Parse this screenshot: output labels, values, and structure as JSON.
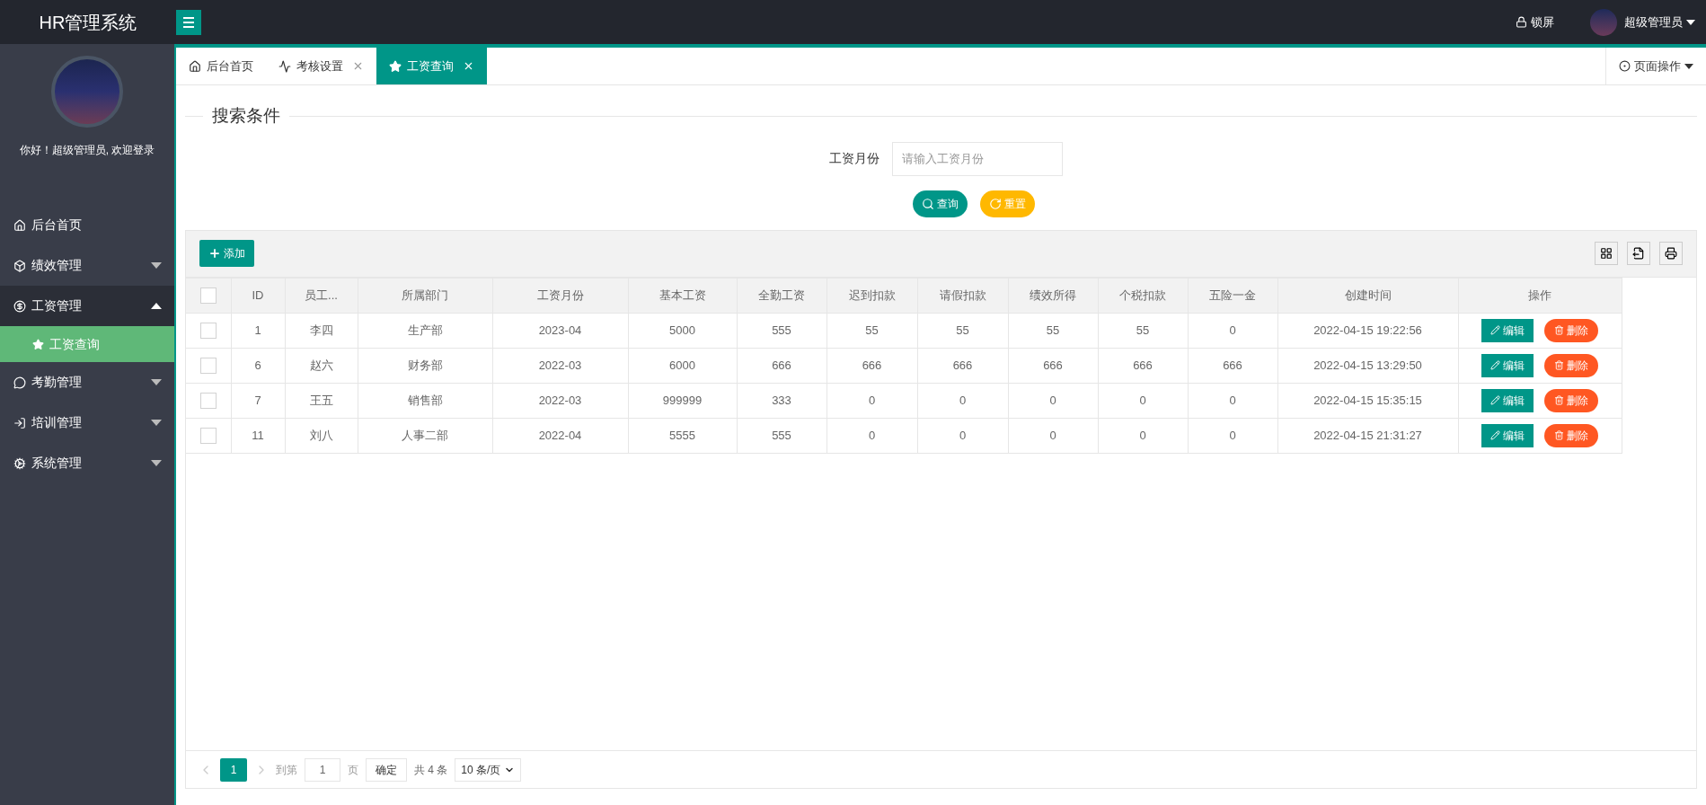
{
  "header": {
    "logo": "HR管理系统",
    "lock_label": "锁屏",
    "user_name": "超级管理员"
  },
  "sidebar": {
    "greeting": "你好！超级管理员, 欢迎登录",
    "items": [
      {
        "label": "后台首页",
        "kind": "link"
      },
      {
        "label": "绩效管理",
        "kind": "menu",
        "expanded": false
      },
      {
        "label": "工资管理",
        "kind": "menu",
        "expanded": true,
        "children": [
          {
            "label": "工资查询",
            "selected": true
          }
        ]
      },
      {
        "label": "考勤管理",
        "kind": "menu",
        "expanded": false
      },
      {
        "label": "培训管理",
        "kind": "menu",
        "expanded": false
      },
      {
        "label": "系统管理",
        "kind": "menu",
        "expanded": false
      }
    ]
  },
  "tabs": [
    {
      "label": "后台首页",
      "selected": false,
      "closable": false
    },
    {
      "label": "考核设置",
      "selected": false,
      "closable": true
    },
    {
      "label": "工资查询",
      "selected": true,
      "closable": true
    }
  ],
  "page_actions": "页面操作",
  "search": {
    "legend": "搜索条件",
    "field_label": "工资月份",
    "placeholder": "请输入工资月份",
    "buttons": [
      "查询",
      "重置"
    ]
  },
  "toolbar": {
    "add_label": "添加"
  },
  "table": {
    "columns": [
      "ID",
      "员工...",
      "所属部门",
      "工资月份",
      "基本工资",
      "全勤工资",
      "迟到扣款",
      "请假扣款",
      "绩效所得",
      "个税扣款",
      "五险一金",
      "创建时间",
      "操作"
    ],
    "select_all_checked": false,
    "rows": [
      {
        "checked": false,
        "cells": [
          "1",
          "李四",
          "生产部",
          "2023-04",
          "5000",
          "555",
          "55",
          "55",
          "55",
          "55",
          "0",
          "2022-04-15 19:22:56"
        ],
        "actions": [
          "编辑",
          "删除"
        ]
      },
      {
        "checked": false,
        "cells": [
          "6",
          "赵六",
          "财务部",
          "2022-03",
          "6000",
          "666",
          "666",
          "666",
          "666",
          "666",
          "666",
          "2022-04-15 13:29:50"
        ],
        "actions": [
          "编辑",
          "删除"
        ]
      },
      {
        "checked": false,
        "cells": [
          "7",
          "王五",
          "销售部",
          "2022-03",
          "999999",
          "333",
          "0",
          "0",
          "0",
          "0",
          "0",
          "2022-04-15 15:35:15"
        ],
        "actions": [
          "编辑",
          "删除"
        ]
      },
      {
        "checked": false,
        "cells": [
          "11",
          "刘八",
          "人事二部",
          "2022-04",
          "5555",
          "555",
          "0",
          "0",
          "0",
          "0",
          "0",
          "2022-04-15 21:31:27"
        ],
        "actions": [
          "编辑",
          "删除"
        ]
      }
    ]
  },
  "pagination": {
    "pages": [
      {
        "label": "1",
        "selected": true
      }
    ],
    "goto_label": "到第",
    "goto_value": "1",
    "page_unit": "页",
    "confirm": "确定",
    "total": "共 4 条",
    "page_size": "10 条/页"
  }
}
